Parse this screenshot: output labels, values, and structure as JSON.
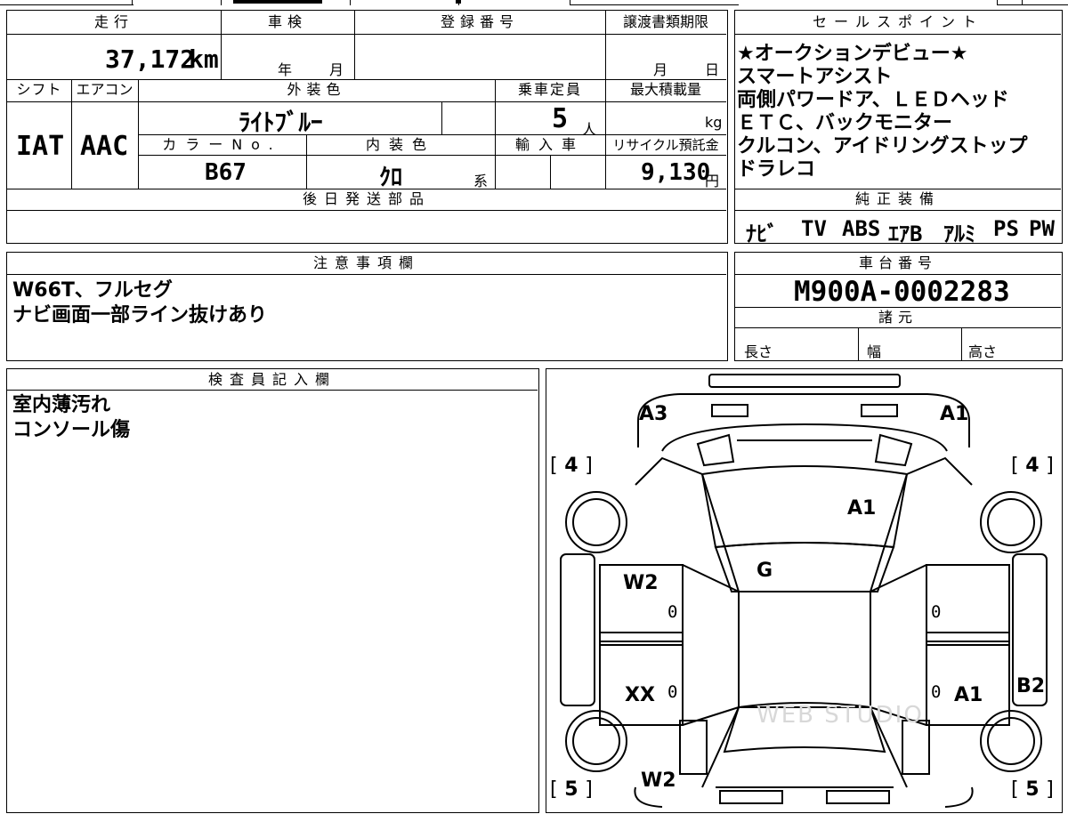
{
  "mileage": {
    "label": "走行",
    "value": "37,172",
    "unit": "km"
  },
  "inspection": {
    "label": "車検",
    "year_unit": "年",
    "month_unit": "月"
  },
  "registration": {
    "label": "登録番号"
  },
  "transfer_deadline": {
    "label": "譲渡書類期限",
    "month_unit": "月",
    "day_unit": "日"
  },
  "shift": {
    "label": "シフト",
    "value": "IAT"
  },
  "aircon": {
    "label": "エアコン",
    "value": "AAC"
  },
  "exterior_color": {
    "label": "外装色",
    "value": "ﾗｲﾄﾌﾞﾙｰ"
  },
  "capacity": {
    "label": "乗車定員",
    "value": "5",
    "unit": "人"
  },
  "max_load": {
    "label": "最大積載量",
    "unit": "kg"
  },
  "color_no": {
    "label": "カラーNo.",
    "value": "B67"
  },
  "interior_color": {
    "label": "内装色",
    "value": "ｸﾛ",
    "suffix": "系"
  },
  "import": {
    "label": "輸入車"
  },
  "recycle": {
    "label": "リサイクル預託金",
    "value": "9,130",
    "unit": "円"
  },
  "later_parts": {
    "label": "後日発送部品"
  },
  "sales_points": {
    "label": "セールスポイント",
    "lines": [
      "★オークションデビュー★",
      "スマートアシスト",
      "両側パワードア、ＬＥＤヘッド",
      "ＥＴＣ、バックモニター",
      "クルコン、アイドリングストップ",
      "ドラレコ"
    ]
  },
  "genuine_equipment": {
    "label": "純正装備",
    "items": [
      "ﾅﾋﾞ",
      "TV",
      "ABS",
      "ｴｱB",
      "ｱﾙﾐ",
      "PS",
      "PW"
    ]
  },
  "notes": {
    "label": "注意事項欄",
    "lines": [
      "W66T、フルセグ",
      "ナビ画面一部ライン抜けあり"
    ]
  },
  "chassis": {
    "label": "車台番号",
    "value": "M900A-0002283"
  },
  "specs": {
    "label": "諸元",
    "length": "長さ",
    "width": "幅",
    "height": "高さ"
  },
  "inspector": {
    "label": "検査員記入欄",
    "lines": [
      "室内薄汚れ",
      "コンソール傷"
    ]
  },
  "diagram": {
    "marks": {
      "a3_front_left": "A3",
      "a1_front_right": "A1",
      "a1_windshield": "A1",
      "g_roof": "G",
      "w2_front_left_door": "W2",
      "xx_rear_left_door": "XX",
      "a1_rear_right_door": "A1",
      "b2_rear_right": "B2",
      "w2_rear_left": "W2"
    },
    "tires": {
      "front_left": "4",
      "front_right": "4",
      "rear_left": "5",
      "rear_right": "5"
    },
    "door_zeros": {
      "fl": "0",
      "fr": "0",
      "rl": "0",
      "rr": "0"
    },
    "watermark": "WEB STUDIO"
  }
}
